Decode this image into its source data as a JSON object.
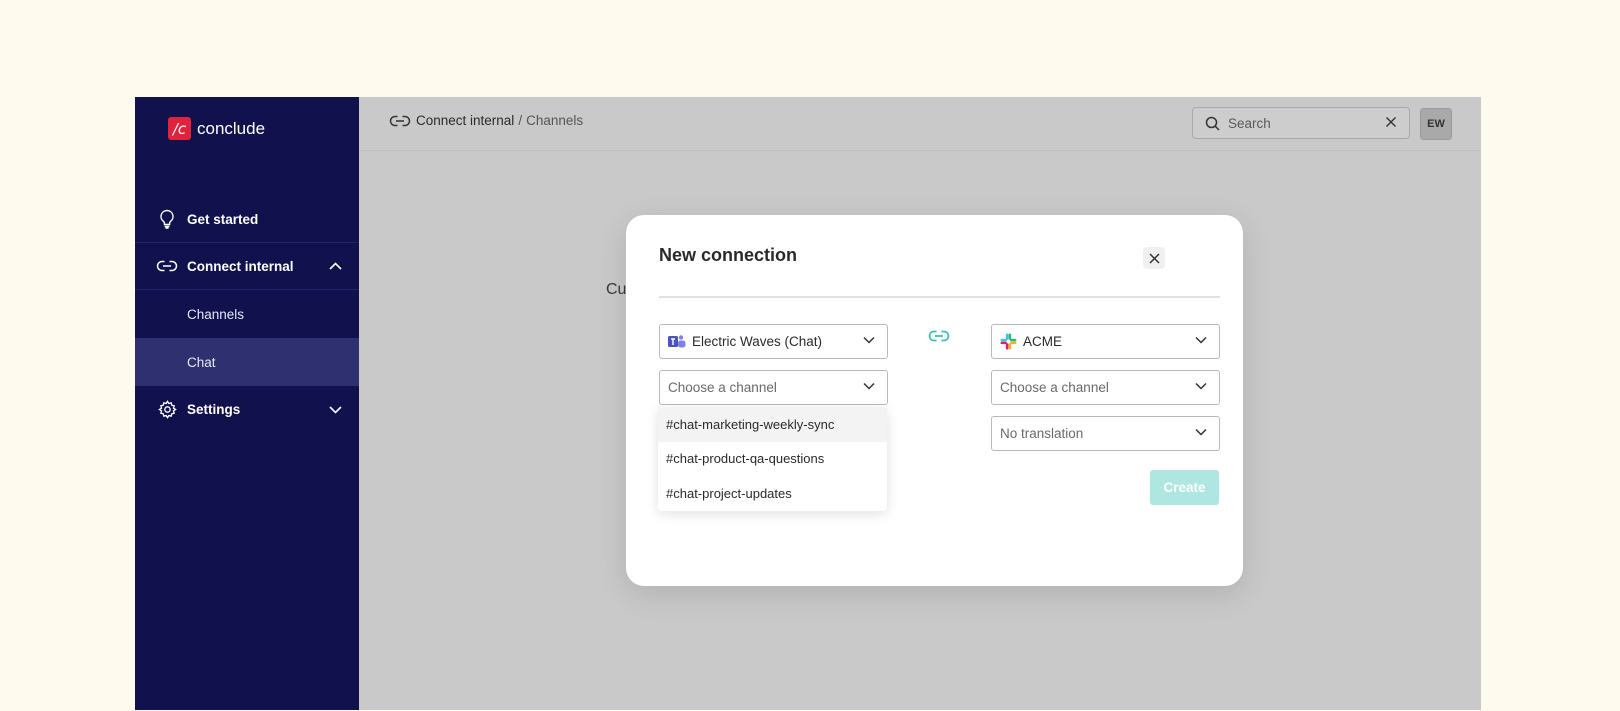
{
  "brand": {
    "logo_mark": "/c",
    "name": "conclude",
    "color": "#e0223d"
  },
  "sidebar": {
    "items": [
      {
        "label": "Get started",
        "icon": "lightbulb-icon"
      },
      {
        "label": "Connect internal",
        "icon": "link-icon",
        "expanded": true,
        "children": [
          {
            "label": "Channels"
          },
          {
            "label": "Chat",
            "active": true
          }
        ]
      },
      {
        "label": "Settings",
        "icon": "gear-icon",
        "expanded": false
      }
    ]
  },
  "topbar": {
    "breadcrumb": {
      "parent": "Connect internal",
      "separator": "/",
      "current": "Channels"
    },
    "search": {
      "placeholder": "Search",
      "value": ""
    },
    "avatar": "EW"
  },
  "background_text": "Cur",
  "modal": {
    "title": "New connection",
    "left": {
      "workspace": {
        "value": "Electric Waves (Chat)",
        "icon": "teams-icon"
      },
      "channel": {
        "placeholder": "Choose a channel"
      },
      "dropdown_options": [
        "#chat-marketing-weekly-sync",
        "#chat-product-qa-questions",
        "#chat-project-updates"
      ]
    },
    "right": {
      "workspace": {
        "value": "ACME",
        "icon": "slack-icon"
      },
      "channel": {
        "placeholder": "Choose a channel"
      },
      "translation": {
        "value": "No translation"
      }
    },
    "create_label": "Create",
    "accent": "#3cbfb4"
  }
}
